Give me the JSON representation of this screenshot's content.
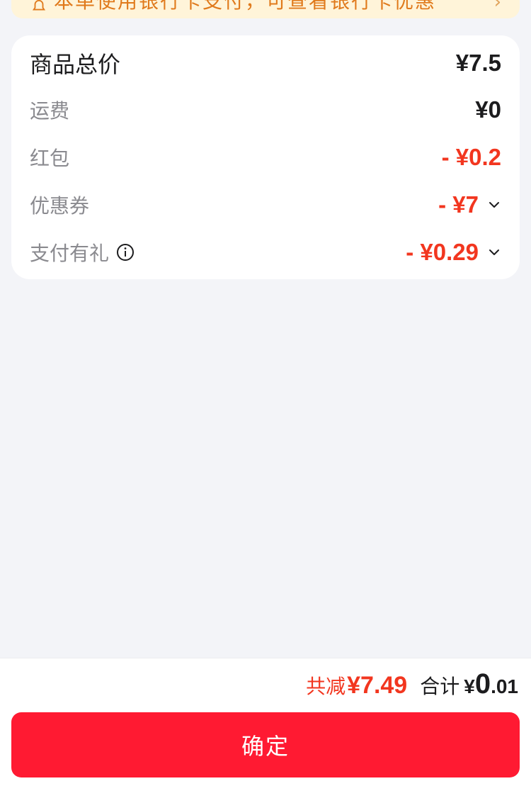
{
  "notice": {
    "text": "本单使用银行卡支付，可查看银行卡优惠"
  },
  "summary": {
    "rows": [
      {
        "label": "商品总价",
        "value": "¥7.5"
      },
      {
        "label": "运费",
        "value": "¥0"
      },
      {
        "label": "红包",
        "value": "- ¥0.2"
      },
      {
        "label": "优惠券",
        "value": "- ¥7"
      },
      {
        "label": "支付有礼",
        "value": "- ¥0.29"
      }
    ]
  },
  "bottom": {
    "saved_label": "共减",
    "saved_value": "¥7.49",
    "total_label": "合计",
    "currency": "¥",
    "total_int": "0",
    "total_dec": ".01",
    "confirm_label": "确定"
  },
  "colors": {
    "accent_red": "#f2361f",
    "button_red": "#ff1a32",
    "notice_bg": "#fff4d9",
    "notice_text": "#e07a1c"
  },
  "icons": {
    "notice": "bell-icon",
    "info": "info-icon",
    "expand": "chevron-down-icon"
  }
}
